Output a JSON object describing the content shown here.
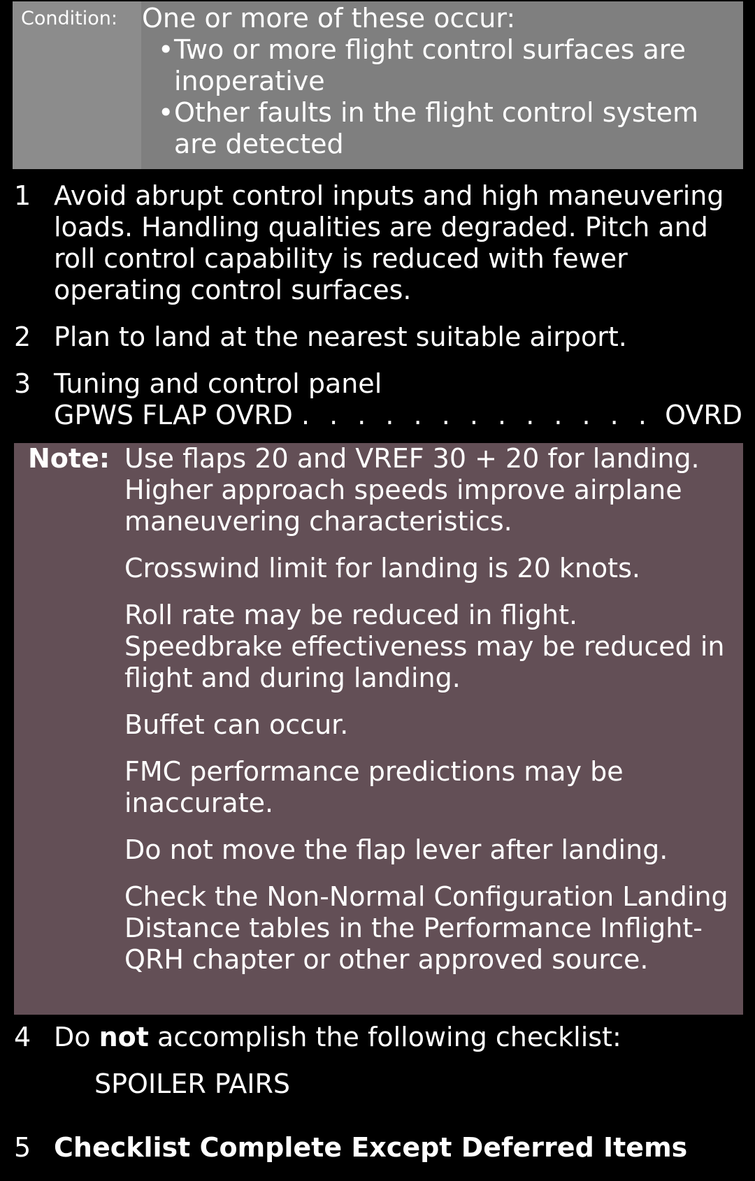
{
  "condition": {
    "label": "Condition:",
    "lead": "One or more of these occur:",
    "bullets": [
      "Two or more flight control surfaces are inoperative",
      "Other faults in the flight control system are detected"
    ]
  },
  "steps": [
    {
      "number": "1",
      "text": "Avoid abrupt control inputs and high maneuvering loads. Handling qualities are degraded. Pitch and roll control capability is reduced with fewer operating control surfaces."
    },
    {
      "number": "2",
      "text": "Plan to land at the nearest suitable airport."
    },
    {
      "number": "3",
      "panel": "Tuning and control panel",
      "item": "GPWS FLAP OVRD",
      "action": "OVRD"
    }
  ],
  "note": {
    "label": "Note:",
    "paragraphs": [
      "Use flaps 20 and VREF 30 + 20 for landing. Higher approach speeds improve airplane maneuvering characteristics.",
      "Crosswind limit for landing is 20 knots.",
      "Roll rate may be reduced in flight. Speedbrake effectiveness may be reduced in flight and during landing.",
      "Buffet can occur.",
      "FMC performance predictions may be inaccurate.",
      "Do not move the flap lever after landing.",
      "Check the Non-Normal Configuration Landing Distance tables in the Performance Inflight-QRH chapter or other approved source."
    ]
  },
  "step4": {
    "number": "4",
    "text_before": "Do ",
    "text_bold": "not",
    "text_after": " accomplish the following checklist:",
    "checklist": "SPOILER PAIRS"
  },
  "step5": {
    "number": "5",
    "text": "Checklist Complete Except Deferred Items"
  },
  "colors": {
    "background": "#000000",
    "condition_box": "#7f7f7f",
    "condition_label_col": "#8c8c8c",
    "note_box": "#634f56",
    "text": "#ffffff"
  }
}
